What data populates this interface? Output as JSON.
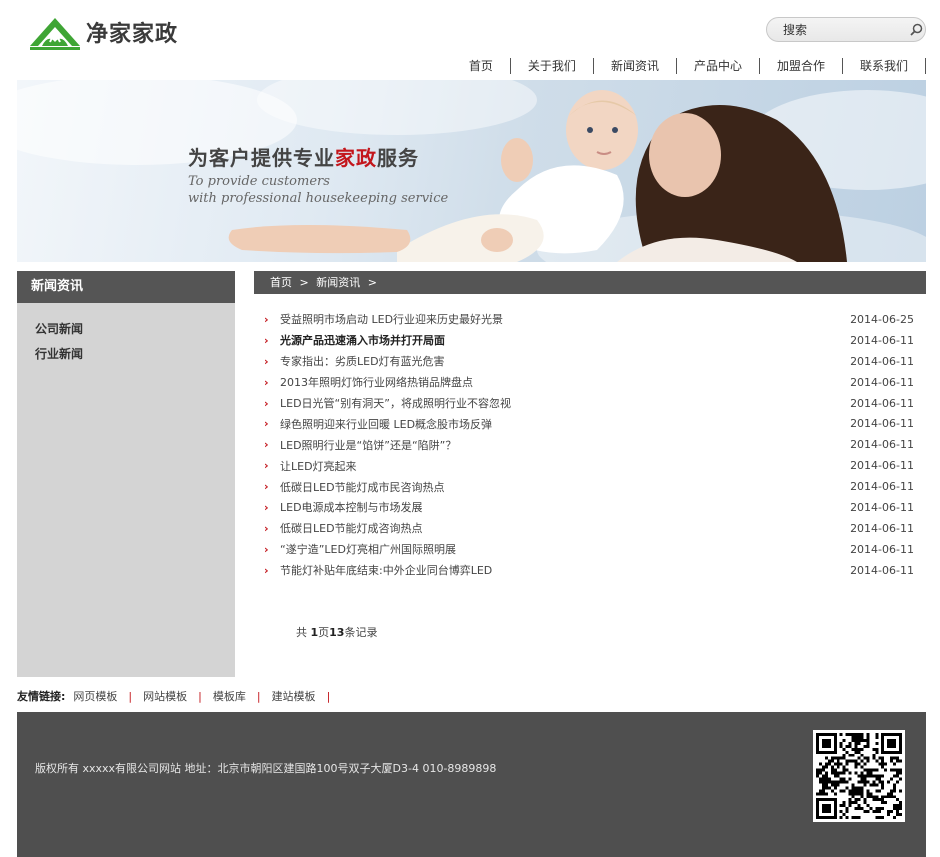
{
  "header": {
    "logo_text": "净家家政",
    "logo_icon": "house-leaf-logo",
    "brand_color": "#3fa535",
    "search": {
      "placeholder": "搜索",
      "icon": "search-icon"
    }
  },
  "nav": {
    "items": [
      {
        "label": "首页"
      },
      {
        "label": "关于我们"
      },
      {
        "label": "新闻资讯"
      },
      {
        "label": "产品中心"
      },
      {
        "label": "加盟合作"
      },
      {
        "label": "联系我们"
      }
    ]
  },
  "banner": {
    "title_part1": "为客户提供专业",
    "title_highlight": "家政",
    "title_part2": "服务",
    "subtitle_line1": "To provide customers",
    "subtitle_line2": "with professional housekeeping service",
    "accent_color": "#c3161c"
  },
  "sidebar": {
    "title": "新闻资讯",
    "items": [
      {
        "label": "公司新闻"
      },
      {
        "label": "行业新闻"
      }
    ]
  },
  "breadcrumb": {
    "home": "首页",
    "current": "新闻资讯",
    "separator": ">"
  },
  "news": [
    {
      "title": "受益照明市场启动 LED行业迎来历史最好光景",
      "date": "2014-06-25",
      "bold": false
    },
    {
      "title": "光源产品迅速涌入市场并打开局面",
      "date": "2014-06-11",
      "bold": true
    },
    {
      "title": "专家指出：劣质LED灯有蓝光危害",
      "date": "2014-06-11",
      "bold": false
    },
    {
      "title": "2013年照明灯饰行业网络热销品牌盘点",
      "date": "2014-06-11",
      "bold": false
    },
    {
      "title": "LED日光管“别有洞天”，将成照明行业不容忽视",
      "date": "2014-06-11",
      "bold": false
    },
    {
      "title": "绿色照明迎来行业回暖 LED概念股市场反弹",
      "date": "2014-06-11",
      "bold": false
    },
    {
      "title": "LED照明行业是“馅饼”还是“陷阱”？",
      "date": "2014-06-11",
      "bold": false
    },
    {
      "title": "让LED灯亮起来",
      "date": "2014-06-11",
      "bold": false
    },
    {
      "title": "低碳日LED节能灯成市民咨询热点",
      "date": "2014-06-11",
      "bold": false
    },
    {
      "title": "LED电源成本控制与市场发展",
      "date": "2014-06-11",
      "bold": false
    },
    {
      "title": "低碳日LED节能灯成咨询热点",
      "date": "2014-06-11",
      "bold": false
    },
    {
      "title": "“遂宁造”LED灯亮相广州国际照明展",
      "date": "2014-06-11",
      "bold": false
    },
    {
      "title": "节能灯补贴年底结束:中外企业同台博弈LED",
      "date": "2014-06-11",
      "bold": false
    }
  ],
  "news_arrow": "›",
  "pager": {
    "prefix": "共 ",
    "pages": "1",
    "page_word": "页",
    "count": "13",
    "suffix": "条记录"
  },
  "friends": {
    "label": "友情链接:",
    "links": [
      {
        "label": "网页模板"
      },
      {
        "label": "网站模板"
      },
      {
        "label": "模板库"
      },
      {
        "label": "建站模板"
      }
    ],
    "separator": "|"
  },
  "footer": {
    "copyright": "版权所有 xxxxx有限公司网站 地址：北京市朝阳区建国路100号双子大厦D3-4 010-8989898",
    "qr_icon": "qr-code-icon",
    "background": "#4f4f4f"
  }
}
